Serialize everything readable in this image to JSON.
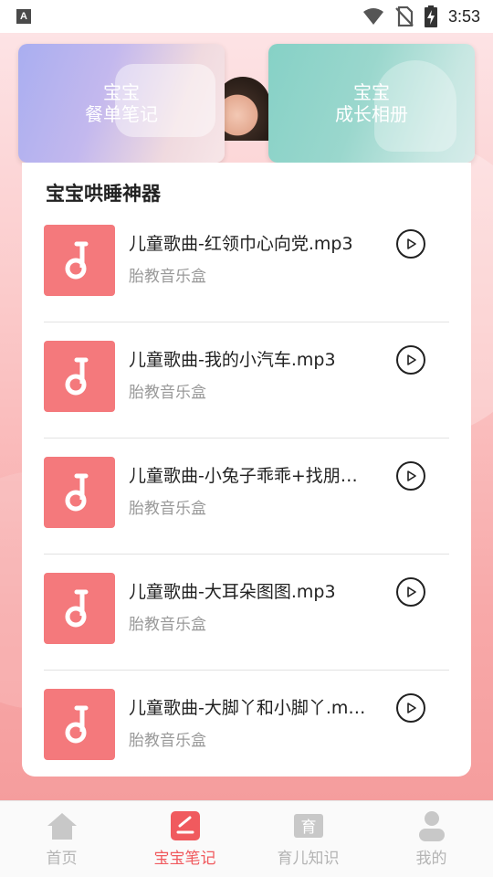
{
  "status_bar": {
    "time": "3:53",
    "left_icon_letter": "A"
  },
  "top_cards": [
    {
      "line1": "宝宝",
      "line2": "餐单笔记"
    },
    {
      "line1": "宝宝",
      "line2": "成长相册"
    }
  ],
  "section": {
    "title": "宝宝哄睡神器"
  },
  "songs": [
    {
      "title": "儿童歌曲-红领巾心向党.mp3",
      "subtitle": "胎教音乐盒"
    },
    {
      "title": "儿童歌曲-我的小汽车.mp3",
      "subtitle": "胎教音乐盒"
    },
    {
      "title": "儿童歌曲-小兔子乖乖+找朋…",
      "subtitle": "胎教音乐盒"
    },
    {
      "title": "儿童歌曲-大耳朵图图.mp3",
      "subtitle": "胎教音乐盒"
    },
    {
      "title": "儿童歌曲-大脚丫和小脚丫.m…",
      "subtitle": "胎教音乐盒"
    }
  ],
  "bottom_nav": [
    {
      "label": "首页",
      "icon": "home-icon",
      "active": false
    },
    {
      "label": "宝宝笔记",
      "icon": "note-icon",
      "active": true
    },
    {
      "label": "育儿知识",
      "icon": "book-icon",
      "active": false
    },
    {
      "label": "我的",
      "icon": "user-icon",
      "active": false
    }
  ],
  "colors": {
    "accent": "#f05a5e",
    "thumb": "#f4797c",
    "inactive": "#b4b4b4"
  }
}
